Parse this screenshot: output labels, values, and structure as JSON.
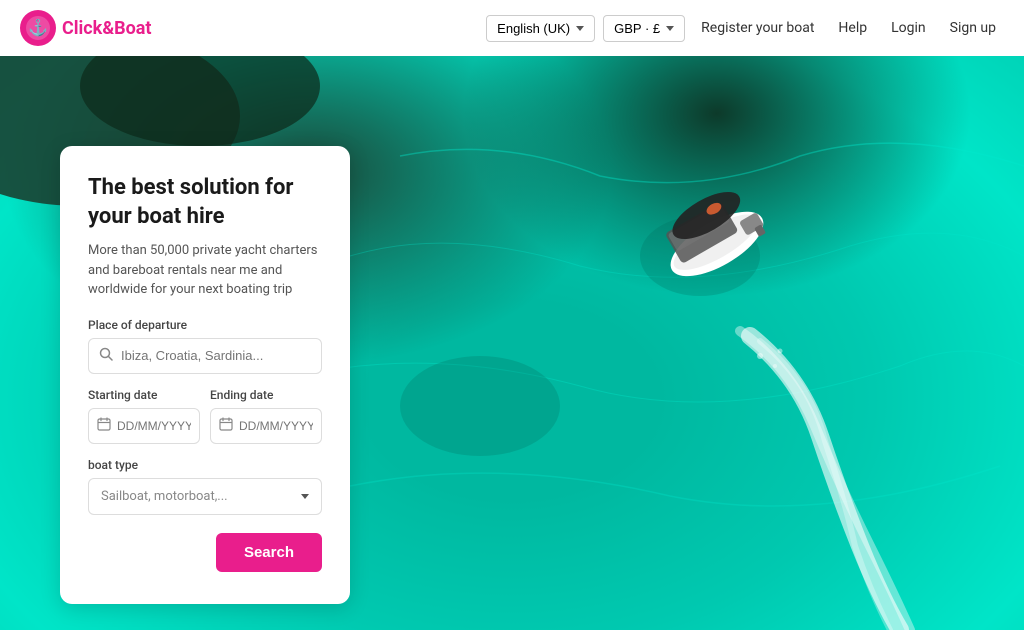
{
  "navbar": {
    "logo_text_part1": "Click",
    "logo_text_part2": "&",
    "logo_text_part3": "Boat",
    "lang_label": "English (UK)",
    "currency_label": "GBP · £",
    "register_label": "Register your boat",
    "help_label": "Help",
    "login_label": "Login",
    "signup_label": "Sign up"
  },
  "hero": {
    "heading_line1": "The best solution for",
    "heading_line2": "your boat hire",
    "subtext": "More than 50,000 private yacht charters and bareboat rentals near me and worldwide for your next boating trip",
    "departure_label": "Place of departure",
    "departure_placeholder": "Ibiza, Croatia, Sardinia...",
    "starting_date_label": "Starting date",
    "starting_date_placeholder": "DD/MM/YYYY",
    "ending_date_label": "Ending date",
    "ending_date_placeholder": "DD/MM/YYYY",
    "boat_type_label": "boat type",
    "boat_type_placeholder": "Sailboat, motorboat,...",
    "search_button": "Search"
  }
}
